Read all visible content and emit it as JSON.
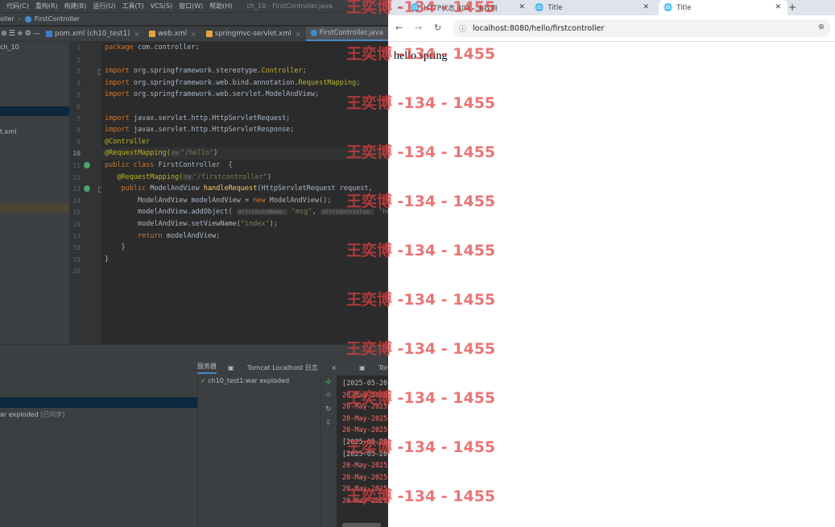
{
  "ide": {
    "menu": [
      "代码(C)",
      "重构(R)",
      "构建(B)",
      "运行(U)",
      "工具(T)",
      "VCS(S)",
      "窗口(W)",
      "帮助(H)"
    ],
    "window_title": "ch_10 - FirstController.java",
    "breadcrumb": [
      "oller",
      "FirstController"
    ],
    "editor_tabs": [
      {
        "label": "pom.xml (ch10_test1)",
        "icon_color": "#3d7ecb",
        "active": false
      },
      {
        "label": "web.xml",
        "icon_color": "#e8a33d",
        "active": false
      },
      {
        "label": "springmvc-servlet.xml",
        "icon_color": "#e8a33d",
        "active": false
      },
      {
        "label": "FirstController.java",
        "icon_color": "#3d8fd1",
        "active": true
      }
    ],
    "project_tree": [
      "ch_10",
      "t.xml"
    ],
    "line_numbers": [
      "1",
      "2",
      "3",
      "4",
      "5",
      "6",
      "7",
      "8",
      "9",
      "10",
      "11",
      "12",
      "13",
      "14",
      "15",
      "16",
      "17",
      "18",
      "19",
      "20"
    ],
    "code": {
      "l1_kw": "package",
      "l1_rest": " com.controller;",
      "l3_kw": "import",
      "l3_rest": " org.springframework.stereotype.",
      "l3_cls": "Controller",
      "l3_end": ";",
      "l4_kw": "import",
      "l4_rest": " org.springframework.web.bind.annotation.",
      "l4_cls": "RequestMapping",
      "l4_end": ";",
      "l5_kw": "import",
      "l5_rest": " org.springframework.web.servlet.ModelAndView;",
      "l7_kw": "import",
      "l7_rest": " javax.servlet.http.HttpServletRequest;",
      "l8_kw": "import",
      "l8_rest": " javax.servlet.http.HttpServletResponse;",
      "l9_an": "@Controller",
      "l10_an": "@RequestMapping(",
      "l10_hint": "©∨",
      "l10_str": "\"/hello\"",
      "l10_end": ")",
      "l11_kw": "public class",
      "l11_rest": " FirstController  {",
      "l12_an": "@RequestMapping(",
      "l12_hint": "©∨",
      "l12_str": "\"/firstcontroller\"",
      "l12_end": ")",
      "l13_kw": "public",
      "l13_rest": " ModelAndView ",
      "l13_fn": "handleRequest",
      "l13_rest2": "(HttpServletRequest request,",
      "l14_code": "ModelAndView modelAndView = ",
      "l14_kw": "new",
      "l14_rest": " ModelAndView();",
      "l15_code": "modelAndView.addObject( ",
      "l15_hint1": "attributeName:",
      "l15_str1": " \"msg\"",
      "l15_mid": ", ",
      "l15_hint2": "attributeValue:",
      "l15_str2": " \"hel",
      "l16_code": "modelAndView.setViewName(",
      "l16_str": "\"index\"",
      "l16_end": ");",
      "l17_kw": "return",
      "l17_rest": " modelAndView;",
      "l18": "}",
      "l19": "}"
    },
    "services": {
      "tabs": [
        "服务器",
        "Tomcat Localhost 日志",
        "Tomcat Catalina"
      ],
      "deployment": "ch10_test1:war exploded",
      "server_item": "ar exploded",
      "server_status": "[已同步]"
    },
    "logs": [
      {
        "text": "[2025-05-20",
        "color": "white"
      },
      {
        "text": "20-May-2025",
        "color": "red"
      },
      {
        "text": "20-May-2025",
        "color": "red"
      },
      {
        "text": "20-May-2025",
        "color": "red"
      },
      {
        "text": "20-May-2025",
        "color": "red"
      },
      {
        "text": "[2025-05-20",
        "color": "white"
      },
      {
        "text": "[2025-05-20",
        "color": "white"
      },
      {
        "text": "20-May-2025",
        "color": "red"
      },
      {
        "text": "20-May-2025",
        "color": "red"
      },
      {
        "text": "20-May-2025",
        "color": "red"
      },
      {
        "text": "20-May-2025",
        "color": "red"
      }
    ]
  },
  "browser": {
    "tabs": [
      {
        "title": "HTTP状态 404 - 未找到",
        "active": false
      },
      {
        "title": "Title",
        "active": false
      },
      {
        "title": "Title",
        "active": true
      }
    ],
    "new_tab": "+",
    "url": "localhost:8080/hello/firstcontroller",
    "content": "hello spring"
  },
  "watermark": {
    "text": "王奕博 -134 - 1455",
    "color": "#e04040"
  }
}
